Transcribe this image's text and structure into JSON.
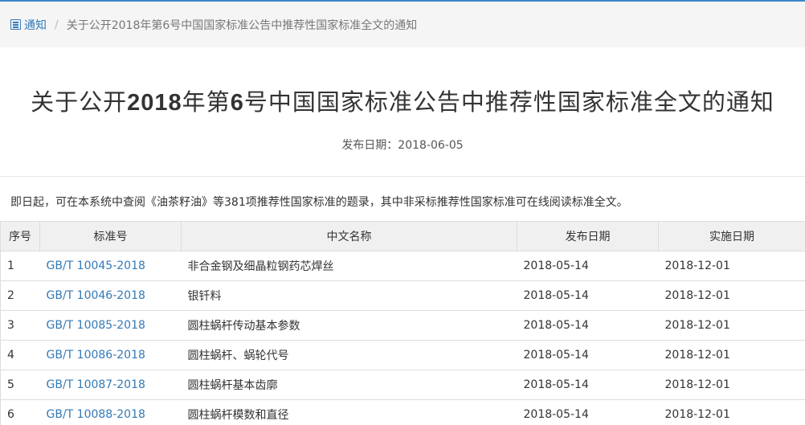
{
  "breadcrumb": {
    "root_label": "通知",
    "separator": "/",
    "current": "关于公开2018年第6号中国国家标准公告中推荐性国家标准全文的通知"
  },
  "page": {
    "title_parts": [
      "关于公开",
      "2018",
      "年第",
      "6",
      "号中国国家标准公告中推荐性国家标准全文的通知"
    ],
    "pubdate": "发布日期：2018-06-05",
    "intro": "即日起，可在本系统中查阅《油茶籽油》等381项推荐性国家标准的题录，其中非采标推荐性国家标准可在线阅读标准全文。"
  },
  "table": {
    "headers": [
      "序号",
      "标准号",
      "中文名称",
      "发布日期",
      "实施日期"
    ],
    "rows": [
      [
        "1",
        "GB/T 10045-2018",
        "非合金钢及细晶粒钢药芯焊丝",
        "2018-05-14",
        "2018-12-01"
      ],
      [
        "2",
        "GB/T 10046-2018",
        "银钎料",
        "2018-05-14",
        "2018-12-01"
      ],
      [
        "3",
        "GB/T 10085-2018",
        "圆柱蜗杆传动基本参数",
        "2018-05-14",
        "2018-12-01"
      ],
      [
        "4",
        "GB/T 10086-2018",
        "圆柱蜗杆、蜗轮代号",
        "2018-05-14",
        "2018-12-01"
      ],
      [
        "5",
        "GB/T 10087-2018",
        "圆柱蜗杆基本齿廓",
        "2018-05-14",
        "2018-12-01"
      ],
      [
        "6",
        "GB/T 10088-2018",
        "圆柱蜗杆模数和直径",
        "2018-05-14",
        "2018-12-01"
      ]
    ]
  },
  "colors": {
    "accent": "#337ab7",
    "header_bg": "#f0f0f0",
    "breadcrumb_bg": "#f5f5f5"
  },
  "icons": {
    "breadcrumb_root": "list-alt-icon"
  }
}
